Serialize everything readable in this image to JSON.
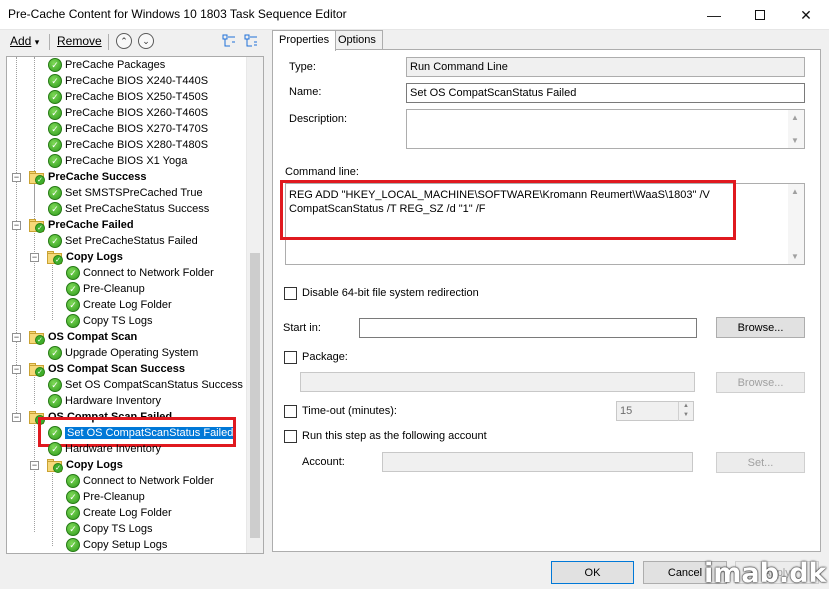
{
  "window": {
    "title": "Pre-Cache Content for Windows 10 1803 Task Sequence Editor",
    "minimize_glyph": "—",
    "close_glyph": "✕"
  },
  "toolbar": {
    "add_label": "Add",
    "add_arrow": "▾",
    "remove_label": "Remove",
    "move_up_glyph": "⌃",
    "move_down_glyph": "⌄"
  },
  "tree": {
    "items": [
      {
        "label": "PreCache Packages",
        "kind": "step"
      },
      {
        "label": "PreCache BIOS X240-T440S",
        "kind": "step"
      },
      {
        "label": "PreCache BIOS X250-T450S",
        "kind": "step"
      },
      {
        "label": "PreCache BIOS X260-T460S",
        "kind": "step"
      },
      {
        "label": "PreCache BIOS X270-T470S",
        "kind": "step"
      },
      {
        "label": "PreCache BIOS X280-T480S",
        "kind": "step"
      },
      {
        "label": "PreCache BIOS X1 Yoga",
        "kind": "step"
      },
      {
        "label": "PreCache Success",
        "kind": "group"
      },
      {
        "label": "Set SMSTSPreCached True",
        "kind": "step"
      },
      {
        "label": "Set PreCacheStatus Success",
        "kind": "step"
      },
      {
        "label": "PreCache Failed",
        "kind": "group"
      },
      {
        "label": "Set PreCacheStatus Failed",
        "kind": "step"
      },
      {
        "label": "Copy Logs",
        "kind": "group"
      },
      {
        "label": "Connect to Network Folder",
        "kind": "step"
      },
      {
        "label": "Pre-Cleanup",
        "kind": "step"
      },
      {
        "label": "Create Log Folder",
        "kind": "step"
      },
      {
        "label": "Copy TS Logs",
        "kind": "step"
      },
      {
        "label": "OS Compat Scan",
        "kind": "group"
      },
      {
        "label": "Upgrade Operating System",
        "kind": "step"
      },
      {
        "label": "OS Compat Scan Success",
        "kind": "group"
      },
      {
        "label": "Set OS CompatScanStatus Success",
        "kind": "step"
      },
      {
        "label": "Hardware Inventory",
        "kind": "step"
      },
      {
        "label": "OS Compat Scan Failed",
        "kind": "group"
      },
      {
        "label": "Set OS CompatScanStatus Failed",
        "kind": "step",
        "selected": true
      },
      {
        "label": "Hardware Inventory",
        "kind": "step"
      },
      {
        "label": "Copy Logs",
        "kind": "group"
      },
      {
        "label": "Connect to Network Folder",
        "kind": "step"
      },
      {
        "label": "Pre-Cleanup",
        "kind": "step"
      },
      {
        "label": "Create Log Folder",
        "kind": "step"
      },
      {
        "label": "Copy TS Logs",
        "kind": "step"
      },
      {
        "label": "Copy Setup Logs",
        "kind": "step"
      }
    ]
  },
  "tabs": {
    "properties": "Properties",
    "options": "Options"
  },
  "properties": {
    "type_label": "Type:",
    "type_value": "Run Command Line",
    "name_label": "Name:",
    "name_value": "Set OS CompatScanStatus Failed",
    "description_label": "Description:",
    "command_line_label": "Command line:",
    "command_line_value": "REG ADD \"HKEY_LOCAL_MACHINE\\SOFTWARE\\Kromann Reumert\\WaaS\\1803\" /V CompatScanStatus /T REG_SZ /d \"1\" /F",
    "disable_64bit_label": "Disable 64-bit file system redirection",
    "start_in_label": "Start in:",
    "browse_label": "Browse...",
    "package_label": "Package:",
    "package_browse_label": "Browse...",
    "timeout_label": "Time-out (minutes):",
    "timeout_value": "15",
    "run_as_label": "Run this step as the following account",
    "account_label": "Account:",
    "set_label": "Set..."
  },
  "footer": {
    "ok_label": "OK",
    "cancel_label": "Cancel",
    "apply_label": "Apply"
  },
  "watermark": "imab.dk",
  "colors": {
    "selection": "#0078d7",
    "highlight_box": "#e0191f",
    "check_green": "#3fae2a",
    "folder_yellow": "#f6d879"
  }
}
